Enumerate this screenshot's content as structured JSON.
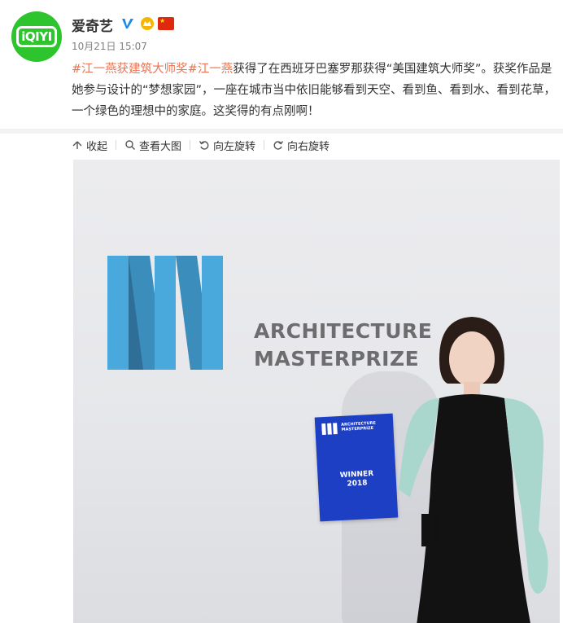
{
  "user": {
    "name": "爱奇艺",
    "avatar_text": "iQIYI",
    "timestamp": "10月21日 15:07"
  },
  "post": {
    "hashtag": "#江一燕获建筑大师奖#",
    "mention": "江一燕",
    "body": "获得了在西班牙巴塞罗那获得“美国建筑大师奖”。获奖作品是她参与设计的“梦想家园”，一座在城市当中依旧能够看到天空、看到鱼、看到水、看到花草，一个绿色的理想中的家庭。这奖得的有点刚啊！"
  },
  "toolbar": {
    "collapse": "收起",
    "view_large": "查看大图",
    "rotate_left": "向左旋转",
    "rotate_right": "向右旋转"
  },
  "photo": {
    "banner_line1": "ARCHITECTURE",
    "banner_line2": "MASTERPRIZE",
    "cert_line1": "ARCHITECTURE",
    "cert_line2": "MASTERPRIZE",
    "cert_winner": "WINNER",
    "cert_year": "2018"
  },
  "colors": {
    "link": "#eb7350",
    "brand_green": "#2ec42e",
    "logo_blue": "#4aa9dc",
    "cert_blue": "#1d3fc4"
  },
  "icons": [
    "verified-icon",
    "badge-icon",
    "flag-icon",
    "collapse-icon",
    "search-icon",
    "rotate-left-icon",
    "rotate-right-icon"
  ]
}
